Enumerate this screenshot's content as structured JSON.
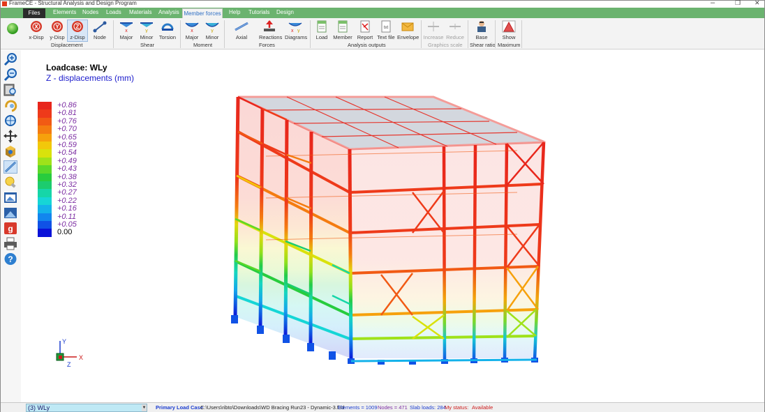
{
  "window": {
    "title": "FrameCE - Structural Analysis and Design Program",
    "minimize": "–",
    "restore": "❐",
    "close": "✕"
  },
  "menu": {
    "files": "Files",
    "items": [
      "Elements",
      "Nodes",
      "Loads",
      "Materials",
      "Analysis"
    ],
    "active": "Member forces",
    "items_after": [
      "Help",
      "Tutorials",
      "Design"
    ]
  },
  "ribbon": {
    "displacement": {
      "label": "Displacement",
      "xdisp": "x-Disp",
      "ydisp": "y-Disp",
      "zdisp": "z-Disp",
      "node": "Node",
      "xdisp_glyph": "X",
      "ydisp_glyph": "Y",
      "zdisp_glyph": "Z"
    },
    "shear": {
      "label": "Shear",
      "major": "Major",
      "minor": "Minor",
      "torsion": "Torsion"
    },
    "moment": {
      "label": "Moment",
      "major": "Major",
      "minor": "Minor"
    },
    "forces": {
      "label": "Forces",
      "axial": "Axial",
      "reactions": "Reactions",
      "diagrams": "Diagrams"
    },
    "analysis_outputs": {
      "label": "Analysis outputs",
      "load": "Load",
      "member": "Member",
      "report": "Report",
      "textfile": "Text file",
      "envelope": "Envelope",
      "textfile_glyph": "txt"
    },
    "graphics_scale": {
      "label": "Graphics scale",
      "increase": "Increase",
      "reduce": "Reduce"
    },
    "shear_ratio": {
      "label": "Shear ratio",
      "base": "Base"
    },
    "maximum": {
      "label": "Maximum",
      "show": "Show"
    }
  },
  "canvas": {
    "loadcase": "Loadcase: WLy",
    "quantity": "Z - displacements (mm)",
    "legend": [
      {
        "value": "+0.86",
        "color": "#e8261c"
      },
      {
        "value": "+0.81",
        "color": "#ee3a1a"
      },
      {
        "value": "+0.76",
        "color": "#f15a14"
      },
      {
        "value": "+0.70",
        "color": "#f47c10"
      },
      {
        "value": "+0.65",
        "color": "#f6a10c"
      },
      {
        "value": "+0.59",
        "color": "#f2c80a"
      },
      {
        "value": "+0.54",
        "color": "#d9e20c"
      },
      {
        "value": "+0.49",
        "color": "#9fe21a"
      },
      {
        "value": "+0.43",
        "color": "#5bd82a"
      },
      {
        "value": "+0.38",
        "color": "#28cc3e"
      },
      {
        "value": "+0.32",
        "color": "#1ccc6e"
      },
      {
        "value": "+0.27",
        "color": "#16d6a8"
      },
      {
        "value": "+0.22",
        "color": "#16d6d6"
      },
      {
        "value": "+0.16",
        "color": "#14b2ea"
      },
      {
        "value": "+0.11",
        "color": "#1286ee"
      },
      {
        "value": "+0.05",
        "color": "#1052e6"
      },
      {
        "value": "0.00",
        "color": "#0a12d8"
      }
    ],
    "axes": {
      "y": "Y",
      "x": "X",
      "z": "Z"
    }
  },
  "status": {
    "loadcase": "(3) WLy",
    "loadcase_type": "Primary Load Case",
    "file": "C:\\Users\\ribto\\Downloads\\WD Bracing Run23 - Dynamic-3.f3d",
    "elements": "Elements = 1009",
    "nodes": "Nodes = 471",
    "slab_loads": "Slab loads: 284",
    "my_status_label": "My status:",
    "my_status": "Available"
  },
  "colors": {
    "menubar": "#6bb36f",
    "accent": "#2d6ec4"
  },
  "icons": [
    "green-ball-icon",
    "x-disp-icon",
    "y-disp-icon",
    "z-disp-icon",
    "node-icon",
    "major-shear-icon",
    "minor-shear-icon",
    "torsion-icon",
    "major-moment-icon",
    "minor-moment-icon",
    "axial-icon",
    "reactions-icon",
    "diagrams-icon",
    "load-icon",
    "member-icon",
    "report-icon",
    "text-file-icon",
    "envelope-icon",
    "increase-icon",
    "reduce-icon",
    "base-icon",
    "show-icon",
    "zoom-in-icon",
    "zoom-out-icon",
    "zoom-window-icon",
    "rotate-icon",
    "zoom-extents-icon",
    "pan-icon",
    "view-3d-icon",
    "member-select-icon",
    "bulb-icon",
    "window-view-icon",
    "image-icon",
    "google-icon",
    "print-icon",
    "help-icon",
    "axis-triad-icon"
  ]
}
